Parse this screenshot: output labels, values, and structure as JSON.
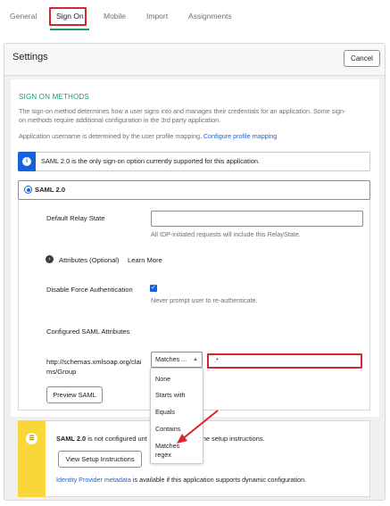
{
  "tabs": [
    {
      "label": "General"
    },
    {
      "label": "Sign On"
    },
    {
      "label": "Mobile"
    },
    {
      "label": "Import"
    },
    {
      "label": "Assignments"
    }
  ],
  "header": {
    "title": "Settings",
    "cancel_label": "Cancel"
  },
  "sign_on": {
    "section_title": "SIGN ON METHODS",
    "description_line1": "The sign-on method determines how a user signs into and manages their credentials for an application. Some sign-",
    "description_line2": "on methods require additional configuration in the 3rd party application.",
    "mapping_text": "Application username is determined by the user profile mapping.",
    "mapping_link": "Configure profile mapping"
  },
  "info": {
    "icon": "info-icon",
    "text": "SAML 2.0 is the only sign-on option currently supported for this application."
  },
  "saml": {
    "radio_label": "SAML 2.0",
    "relay_label": "Default Relay State",
    "relay_value": "",
    "relay_hint": "All IDP-initiated requests will include this RelayState.",
    "attributes_label": "Attributes (Optional)",
    "learn_more": "Learn More",
    "force_auth_label": "Disable Force Authentication",
    "force_auth_hint": "Never prompt user to re-authenticate.",
    "configured_label": "Configured SAML Attributes",
    "attr_name_line1": "http://schemas.xmlsoap.org/clai",
    "attr_name_line2": "ms/Group",
    "match_selected": "Matches ...",
    "regex_value": ".*",
    "preview_label": "Preview SAML",
    "dropdown_options": [
      "None",
      "Starts with",
      "Equals",
      "Contains",
      "Matches",
      "regex"
    ]
  },
  "warning": {
    "bold": "SAML 2.0",
    "text_part1": " is not configured unt",
    "text_part2": "he setup instructions.",
    "setup_button": "View Setup Instructions",
    "idp_link": "Identity Provider metadata",
    "idp_text": " is available if this application supports dynamic configuration."
  },
  "colors": {
    "accent": "#1662dd",
    "active_tab": "#1a9d6e",
    "highlight": "#d8262c",
    "warning": "#f9d63a"
  }
}
